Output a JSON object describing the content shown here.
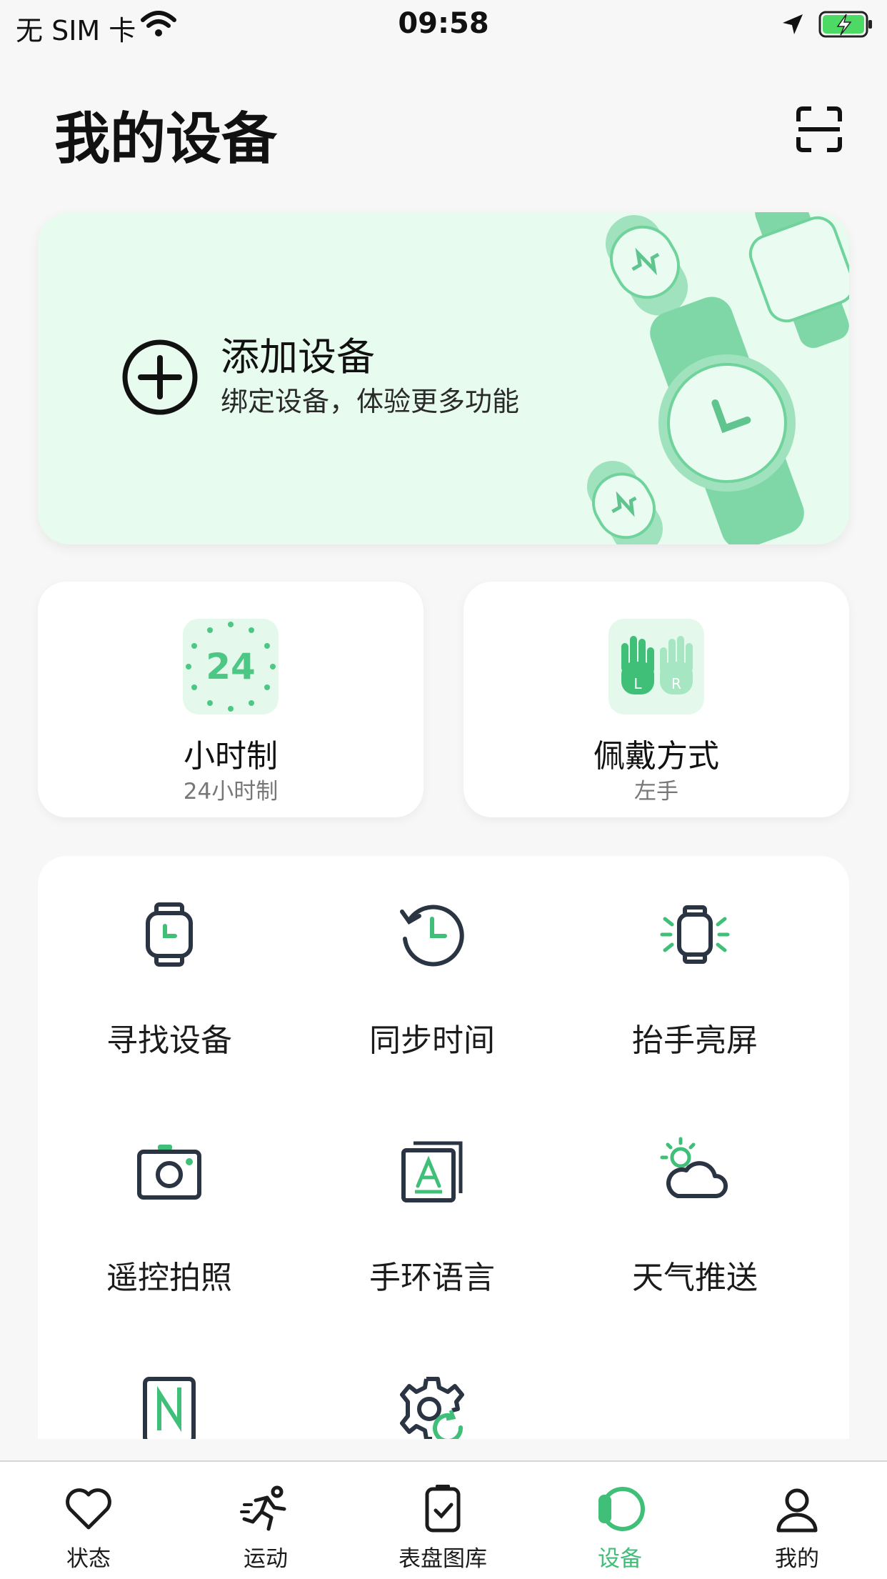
{
  "status_bar": {
    "carrier": "无 SIM 卡",
    "time": "09:58"
  },
  "header": {
    "title": "我的设备",
    "scan_icon": "scan-icon"
  },
  "add_device": {
    "title": "添加设备",
    "subtitle": "绑定设备，体验更多功能",
    "icon": "plus-circle-icon"
  },
  "quick_cards": [
    {
      "title": "小时制",
      "value": "24小时制",
      "icon": "24-hour-icon",
      "icon_text": "24"
    },
    {
      "title": "佩戴方式",
      "value": "左手",
      "icon": "hands-lr-icon",
      "left": "L",
      "right": "R"
    }
  ],
  "features": [
    {
      "label": "寻找设备",
      "icon": "watch-icon"
    },
    {
      "label": "同步时间",
      "icon": "clock-sync-icon"
    },
    {
      "label": "抬手亮屏",
      "icon": "watch-shine-icon"
    },
    {
      "label": "遥控拍照",
      "icon": "camera-icon"
    },
    {
      "label": "手环语言",
      "icon": "language-icon"
    },
    {
      "label": "天气推送",
      "icon": "weather-icon"
    },
    {
      "label": "",
      "icon": "nfc-icon"
    },
    {
      "label": "",
      "icon": "settings-reset-icon"
    }
  ],
  "tabs": [
    {
      "label": "状态",
      "icon": "heart-icon",
      "active": false
    },
    {
      "label": "运动",
      "icon": "running-icon",
      "active": false
    },
    {
      "label": "表盘图库",
      "icon": "watch-face-icon",
      "active": false
    },
    {
      "label": "设备",
      "icon": "device-icon",
      "active": true
    },
    {
      "label": "我的",
      "icon": "profile-icon",
      "active": false
    }
  ],
  "colors": {
    "accent": "#3fbf77",
    "card_bg": "#e7fbef",
    "icon_dark": "#2b3442"
  }
}
